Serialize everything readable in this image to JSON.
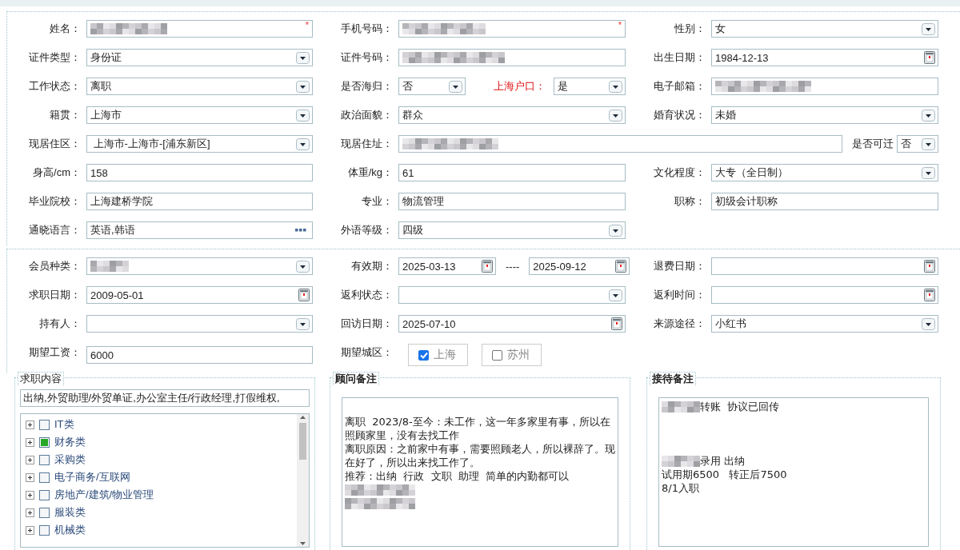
{
  "section_1": {
    "fields": [
      {
        "kind": "normal",
        "label": "姓名：",
        "field": {
          "kind": "text",
          "blurred": true,
          "required_mark": "*"
        }
      },
      {
        "kind": "normal",
        "label": "手机号码：",
        "field": {
          "kind": "text",
          "blurred": true,
          "required_mark": "*"
        }
      },
      {
        "kind": "normal",
        "label": "性别：",
        "field": {
          "kind": "select",
          "value": "女"
        }
      },
      {
        "kind": "normal",
        "label": "证件类型：",
        "field": {
          "kind": "select",
          "value": "身份证"
        }
      },
      {
        "kind": "normal",
        "label": "证件号码：",
        "field": {
          "kind": "text",
          "blurred": true
        }
      },
      {
        "kind": "normal",
        "label": "出生日期：",
        "field": {
          "kind": "date",
          "value": "1984-12-13"
        }
      },
      {
        "kind": "normal",
        "label": "工作状态：",
        "field": {
          "kind": "select",
          "value": "离职"
        }
      },
      {
        "kind": "normal",
        "label": "是否海归：",
        "field": {
          "kind": "select",
          "value": "否"
        },
        "extra": {
          "kind": "label",
          "text": "上海户口：",
          "alert": true,
          "field": {
            "kind": "select",
            "value": "是"
          }
        }
      },
      {
        "kind": "normal",
        "label": "电子邮箱：",
        "field": {
          "kind": "text",
          "blurred": true
        }
      },
      {
        "kind": "normal",
        "label": "籍贯：",
        "field": {
          "kind": "select",
          "value": "上海市"
        }
      },
      {
        "kind": "normal",
        "label": "政治面貌：",
        "field": {
          "kind": "select",
          "value": "群众"
        }
      },
      {
        "kind": "normal",
        "label": "婚育状况：",
        "field": {
          "kind": "select",
          "value": "未婚"
        }
      },
      {
        "kind": "normal",
        "label": "现居住区：",
        "field": {
          "kind": "select",
          "value": " 上海市-上海市-[浦东新区]"
        }
      },
      {
        "kind": "wide",
        "label": "现居住址：",
        "field": {
          "kind": "text",
          "blurred": true
        },
        "extra": {
          "kind": "label",
          "text": "是否可迁",
          "alert": false,
          "field": {
            "kind": "select",
            "value": "否"
          }
        }
      },
      {
        "kind": "normal",
        "label": "身高/cm：",
        "field": {
          "kind": "text",
          "value": "158"
        }
      },
      {
        "kind": "normal",
        "label": "体重/kg：",
        "field": {
          "kind": "text",
          "value": "61"
        }
      },
      {
        "kind": "normal",
        "label": "文化程度：",
        "field": {
          "kind": "select",
          "value": "大专（全日制）"
        }
      },
      {
        "kind": "normal",
        "label": "毕业院校：",
        "field": {
          "kind": "text",
          "value": "上海建桥学院"
        }
      },
      {
        "kind": "normal",
        "label": "专业：",
        "field": {
          "kind": "text",
          "value": "物流管理"
        }
      },
      {
        "kind": "normal",
        "label": "职称：",
        "field": {
          "kind": "text",
          "value": "初级会计职称"
        }
      },
      {
        "kind": "normal",
        "label": "通晓语言：",
        "field": {
          "kind": "picker",
          "value": "英语,韩语"
        }
      },
      {
        "kind": "normal",
        "label": "外语等级：",
        "field": {
          "kind": "select",
          "value": "四级"
        }
      }
    ]
  },
  "section_2": {
    "fields": [
      {
        "kind": "normal",
        "label": "会员种类：",
        "field": {
          "kind": "select",
          "blurred": true
        }
      },
      {
        "kind": "normal",
        "label": "有效期：",
        "field": {
          "kind": "date",
          "value": "2025-03-13"
        },
        "extra": {
          "kind": "range",
          "text": "----",
          "field": {
            "kind": "date",
            "value": "2025-09-12"
          }
        }
      },
      {
        "kind": "normal",
        "label": "退费日期：",
        "field": {
          "kind": "date"
        }
      },
      {
        "kind": "normal",
        "label": "求职日期：",
        "field": {
          "kind": "date",
          "value": "2009-05-01"
        }
      },
      {
        "kind": "normal",
        "label": "返利状态：",
        "field": {
          "kind": "select"
        }
      },
      {
        "kind": "normal",
        "label": "返利时间：",
        "field": {
          "kind": "date"
        }
      },
      {
        "kind": "normal",
        "label": "持有人：",
        "field": {
          "kind": "select"
        }
      },
      {
        "kind": "normal",
        "label": "回访日期：",
        "field": {
          "kind": "date",
          "value": "2025-07-10"
        }
      },
      {
        "kind": "normal",
        "label": "来源途径：",
        "field": {
          "kind": "select",
          "value": "小红书"
        }
      },
      {
        "kind": "normal",
        "label": "期望工资：",
        "field": {
          "kind": "text",
          "value": "6000"
        }
      },
      {
        "kind": "normal",
        "label": "期望城区：",
        "field": {
          "kind": "checkboxes",
          "options": [
            {
              "label": "上海",
              "checked": true
            },
            {
              "label": "苏州",
              "checked": false
            }
          ]
        }
      }
    ]
  },
  "job_panel": {
    "legend": "求职内容",
    "summary": "出纳,外贸助理/外贸单证,办公室主任/行政经理,打假维权,",
    "categories": [
      {
        "label": "IT类",
        "checked": false
      },
      {
        "label": "财务类",
        "checked": true
      },
      {
        "label": "采购类",
        "checked": false
      },
      {
        "label": "电子商务/互联网",
        "checked": false
      },
      {
        "label": "房地产/建筑/物业管理",
        "checked": false
      },
      {
        "label": "服装类",
        "checked": false
      },
      {
        "label": "机械类",
        "checked": false
      }
    ]
  },
  "consultant_notes": {
    "legend": "顾问备注",
    "lines": [
      {
        "kind": "blank"
      },
      {
        "kind": "text",
        "text": "离职  2023/8-至今：未工作，这一年多家里有事，所以在照顾家里，没有去找工作"
      },
      {
        "kind": "text",
        "text": "离职原因：之前家中有事，需要照顾老人，所以裸辞了。现在好了，所以出来找工作了。"
      },
      {
        "kind": "text",
        "text": "推荐：出纳  行政  文职  助理  简单的内勤都可以"
      },
      {
        "kind": "blurred"
      },
      {
        "kind": "blurred"
      }
    ]
  },
  "reception_notes": {
    "legend": "接待备注",
    "lines": [
      {
        "kind": "blurred_text",
        "text": "转账  协议已回传"
      },
      {
        "kind": "blank"
      },
      {
        "kind": "blank"
      },
      {
        "kind": "blank"
      },
      {
        "kind": "blurred_text",
        "text": "录用 出纳"
      },
      {
        "kind": "text",
        "text": "试用期6500   转正后7500"
      },
      {
        "kind": "text",
        "text": "8/1入职"
      }
    ]
  }
}
